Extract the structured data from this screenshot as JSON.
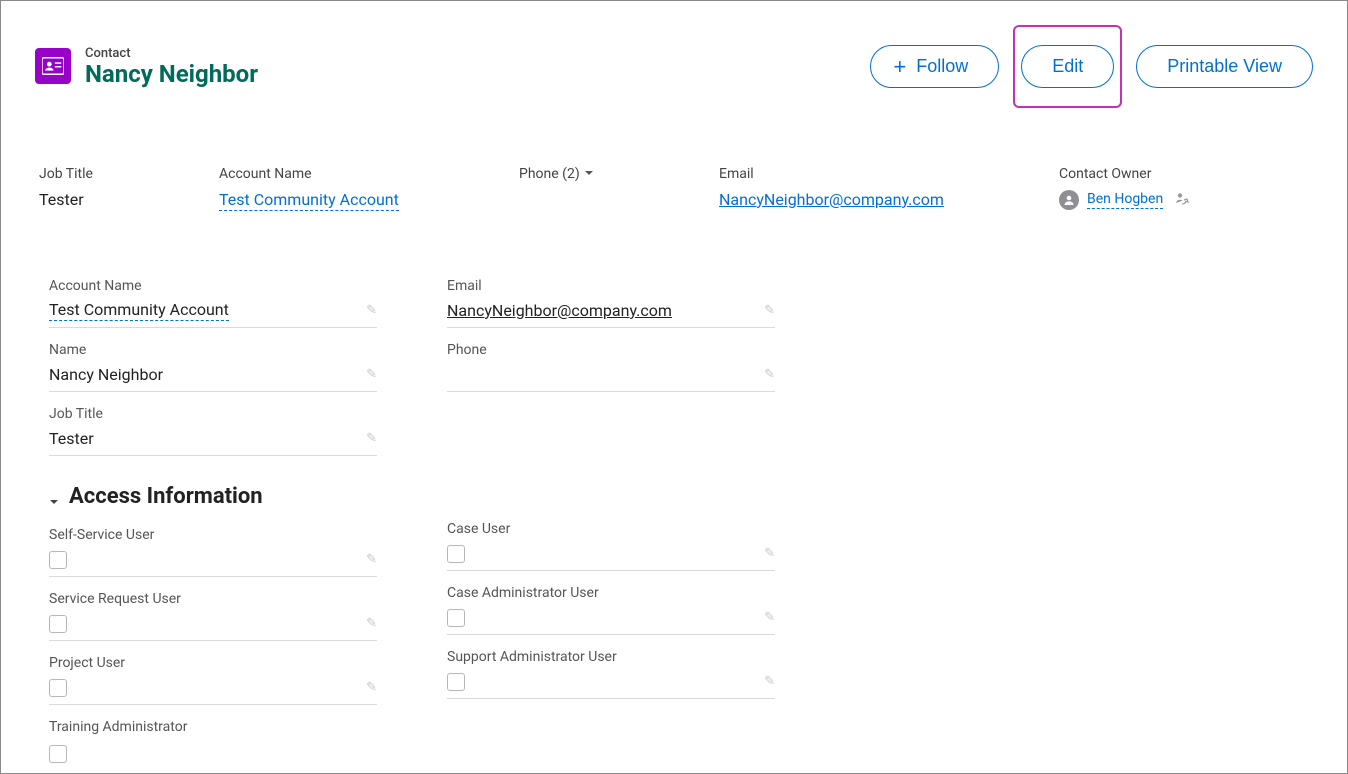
{
  "header": {
    "object_label": "Contact",
    "record_name": "Nancy Neighbor",
    "actions": {
      "follow": "Follow",
      "edit": "Edit",
      "printable": "Printable View"
    }
  },
  "summary": {
    "job_title": {
      "label": "Job Title",
      "value": "Tester"
    },
    "account_name": {
      "label": "Account Name",
      "value": "Test Community Account"
    },
    "phone": {
      "label": "Phone (2)",
      "value": ""
    },
    "email": {
      "label": "Email",
      "value": "NancyNeighbor@company.com"
    },
    "owner": {
      "label": "Contact Owner",
      "value": "Ben Hogben"
    }
  },
  "details": {
    "left": [
      {
        "label": "Account Name",
        "value": "Test Community Account",
        "link": true,
        "dotted": true
      },
      {
        "label": "Name",
        "value": "Nancy Neighbor"
      },
      {
        "label": "Job Title",
        "value": "Tester"
      }
    ],
    "right": [
      {
        "label": "Email",
        "value": "NancyNeighbor@company.com",
        "link": true
      },
      {
        "label": "Phone",
        "value": ""
      }
    ]
  },
  "access": {
    "section_title": "Access Information",
    "left": [
      {
        "label": "Self-Service User"
      },
      {
        "label": "Service Request User"
      },
      {
        "label": "Project User"
      },
      {
        "label": "Training Administrator"
      }
    ],
    "right": [
      {
        "label": "Case User"
      },
      {
        "label": "Case Administrator User"
      },
      {
        "label": "Support Administrator User"
      }
    ]
  }
}
